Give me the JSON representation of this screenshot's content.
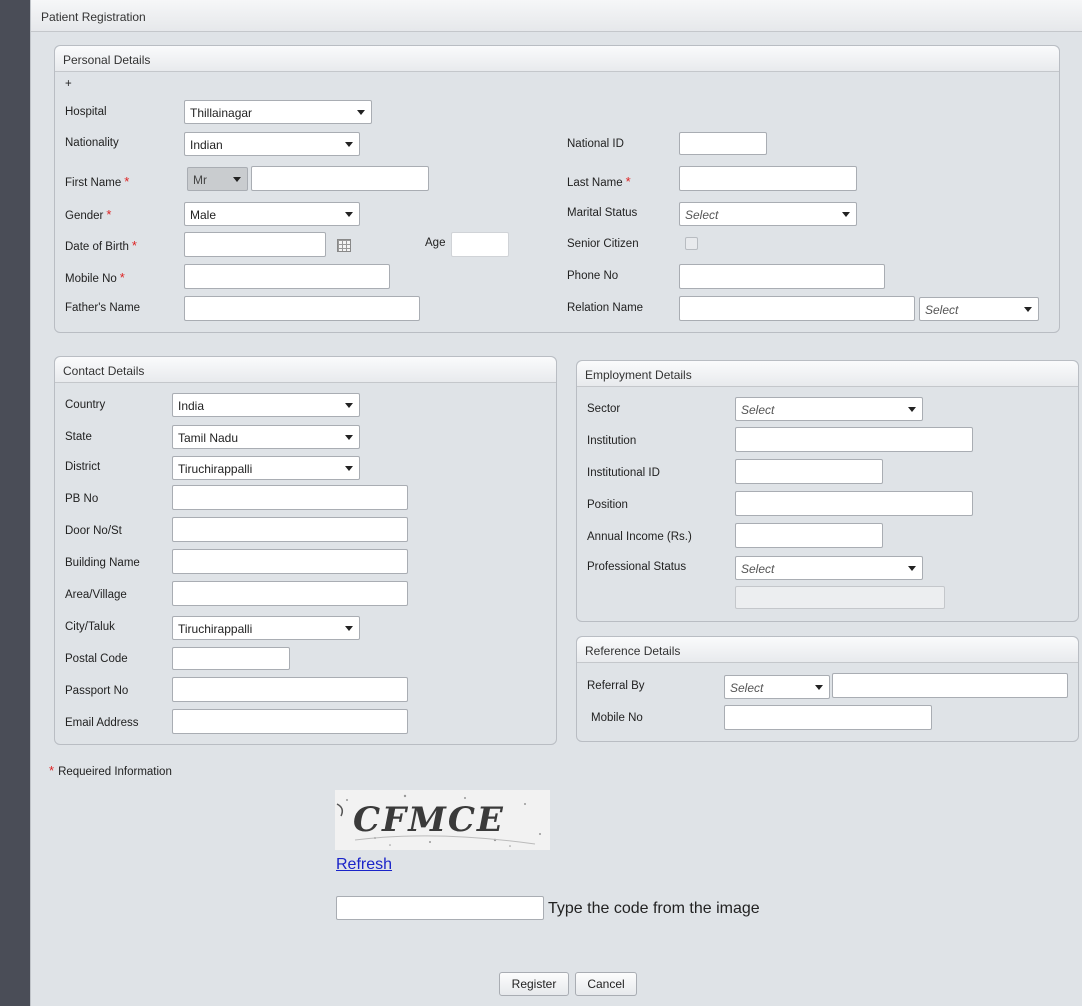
{
  "panel": {
    "title": "Patient Registration"
  },
  "personal": {
    "title": "Personal Details",
    "plus": "+",
    "hospital_label": "Hospital",
    "hospital_value": "Thillainagar",
    "nationality_label": "Nationality",
    "nationality_value": "Indian",
    "national_id_label": "National ID",
    "first_name_label": "First Name",
    "title_value": "Mr",
    "last_name_label": "Last Name",
    "gender_label": "Gender",
    "gender_value": "Male",
    "marital_label": "Marital Status",
    "marital_value": "Select",
    "dob_label": "Date of Birth",
    "age_label": "Age",
    "senior_label": "Senior Citizen",
    "mobile_label": "Mobile No",
    "phone_label": "Phone No",
    "father_label": "Father's Name",
    "relation_label": "Relation Name",
    "relation_value": "Select",
    "required_mark": "*"
  },
  "contact": {
    "title": "Contact Details",
    "country_label": "Country",
    "country_value": "India",
    "state_label": "State",
    "state_value": "Tamil Nadu",
    "district_label": "District",
    "district_value": "Tiruchirappalli",
    "pb_label": "PB No",
    "door_label": "Door No/St",
    "building_label": "Building Name",
    "area_label": "Area/Village",
    "city_label": "City/Taluk",
    "city_value": "Tiruchirappalli",
    "postal_label": "Postal Code",
    "passport_label": "Passport No",
    "email_label": "Email Address"
  },
  "employment": {
    "title": "Employment Details",
    "sector_label": "Sector",
    "sector_value": "Select",
    "institution_label": "Institution",
    "inst_id_label": "Institutional ID",
    "position_label": "Position",
    "income_label": "Annual Income (Rs.)",
    "prof_label": "Professional Status",
    "prof_value": "Select"
  },
  "reference": {
    "title": "Reference Details",
    "referral_label": "Referral By",
    "referral_value": "Select",
    "mobile_label": "Mobile No"
  },
  "footer": {
    "required_note": "Requeired Information",
    "captcha_text": "CFMCE",
    "refresh": "Refresh",
    "captcha_hint": "Type the code from the image",
    "register": "Register",
    "cancel": "Cancel"
  }
}
